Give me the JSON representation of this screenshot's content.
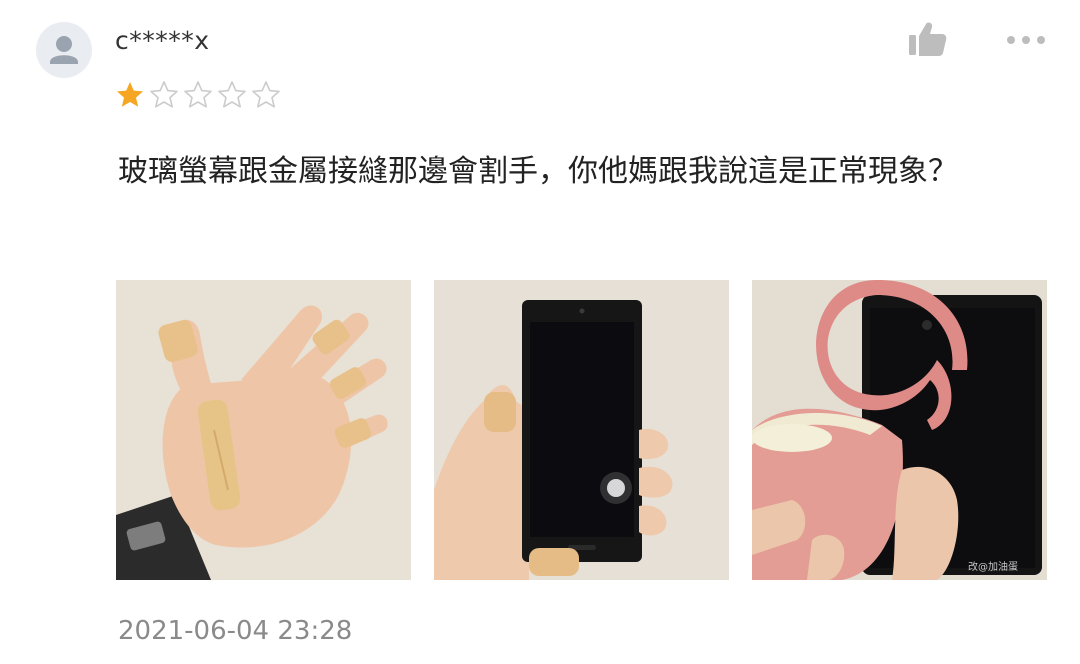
{
  "review": {
    "username": "c*****x",
    "rating": 1,
    "max_rating": 5,
    "text": "玻璃螢幕跟金屬接縫那邊會割手，你他媽跟我說這是正常現象？",
    "timestamp": "2021-06-04 23:28",
    "watermark": "改@加油蛋"
  },
  "colors": {
    "star_filled": "#f5a623",
    "star_empty": "#cccccc",
    "avatar_bg": "#e9ecf0",
    "avatar_fg": "#9aa4b0",
    "icon_gray": "#bdbdbd",
    "timestamp": "#8a8a8a"
  },
  "icons": {
    "avatar": "user-silhouette-icon",
    "like": "thumbs-up-icon",
    "more": "ellipsis-icon",
    "star": "star-icon"
  }
}
